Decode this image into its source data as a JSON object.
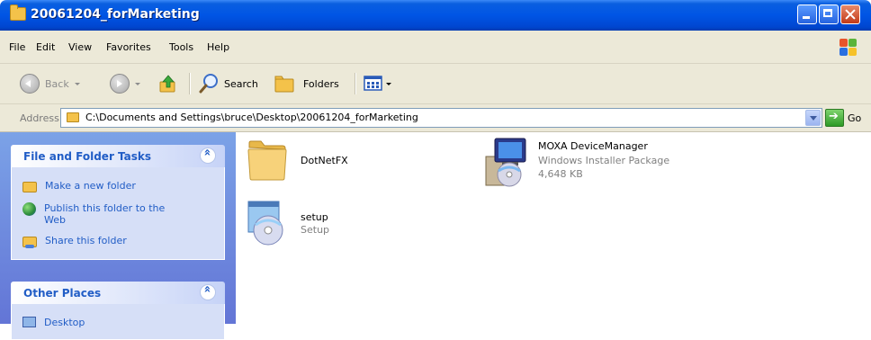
{
  "window": {
    "title": "20061204_forMarketing"
  },
  "menu": [
    "File",
    "Edit",
    "View",
    "Favorites",
    "Tools",
    "Help"
  ],
  "toolbar": {
    "back_label": "Back",
    "search_label": "Search",
    "folders_label": "Folders"
  },
  "address": {
    "label": "Address",
    "path": "C:\\Documents and Settings\\bruce\\Desktop\\20061204_forMarketing",
    "go_label": "Go"
  },
  "taskpane": {
    "file_tasks": {
      "title": "File and Folder Tasks",
      "items": [
        {
          "label": "Make a new folder",
          "icon": "new-folder-icon"
        },
        {
          "label": "Publish this folder to the Web",
          "icon": "globe-icon"
        },
        {
          "label": "Share this folder",
          "icon": "share-folder-icon"
        }
      ]
    },
    "other_places": {
      "title": "Other Places",
      "items": [
        {
          "label": "Desktop",
          "icon": "desktop-icon"
        }
      ]
    }
  },
  "files": [
    {
      "name": "DotNetFX",
      "type": "",
      "size": "",
      "icon": "folder-icon"
    },
    {
      "name": "MOXA DeviceManager",
      "type": "Windows Installer Package",
      "size": "4,648 KB",
      "icon": "installer-package-icon"
    },
    {
      "name": "setup",
      "type": "Setup",
      "size": "",
      "icon": "setup-icon"
    }
  ],
  "colors": {
    "titlebar": "#0055e5",
    "taskpane": "#6f8fe0",
    "link": "#215dc6"
  }
}
